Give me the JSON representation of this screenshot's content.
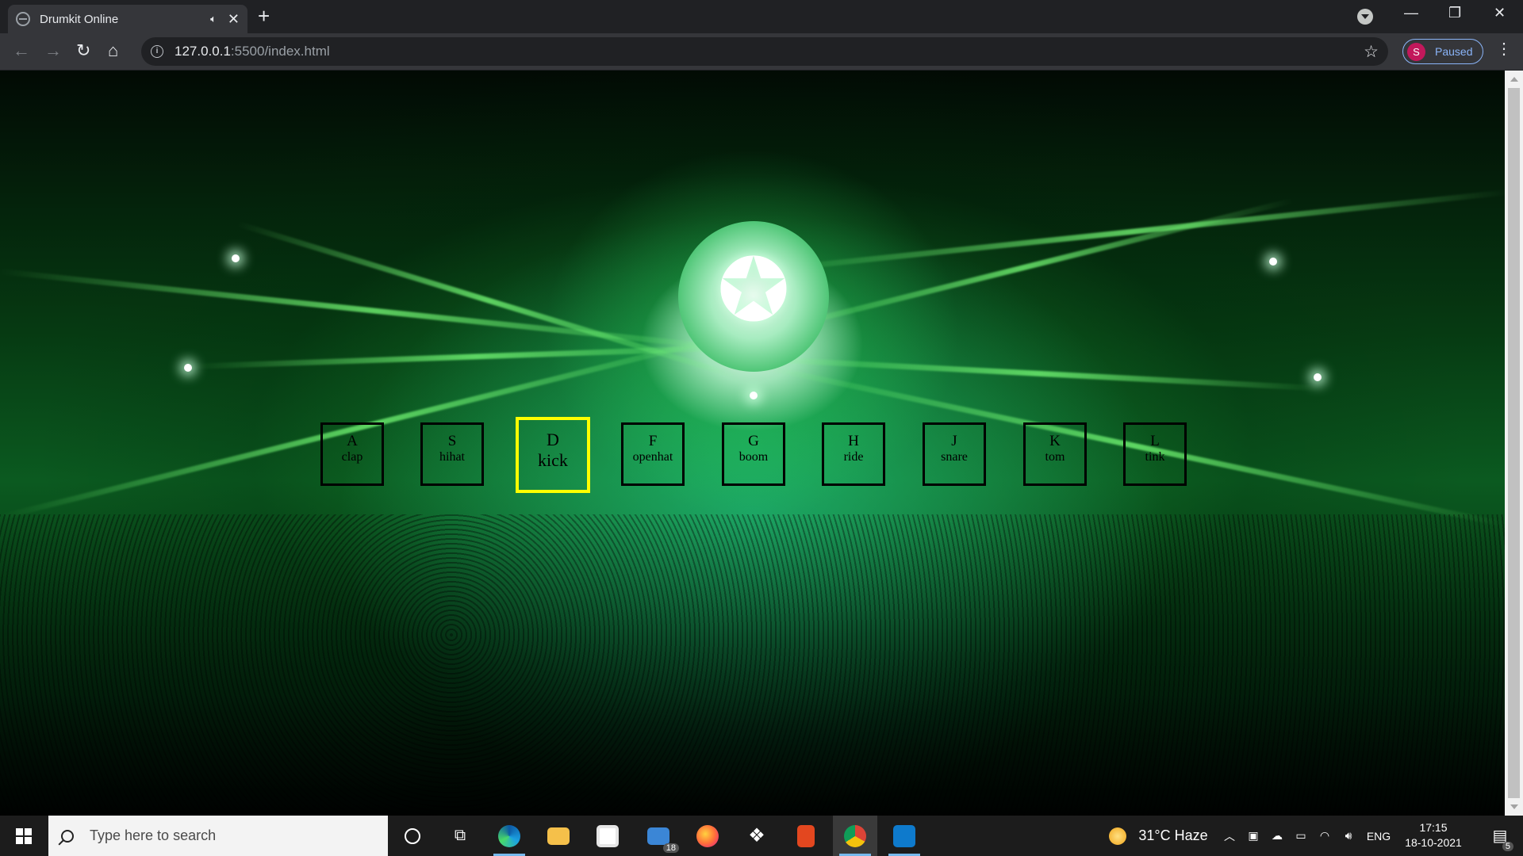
{
  "tab": {
    "title": "Drumkit Online",
    "speaker_icon": "speaker-icon",
    "close": "✕"
  },
  "new_tab": "+",
  "window_controls": {
    "minimize": "—",
    "maximize": "❐",
    "close": "✕"
  },
  "toolbar": {
    "back": "←",
    "forward": "→",
    "reload": "↻",
    "home": "⌂",
    "url_host": "127.0.0.1",
    "url_path": ":5500/index.html",
    "bookmark": "☆",
    "profile_initial": "S",
    "profile_status": "Paused",
    "menu": "⋮"
  },
  "hero": {
    "star_glyph": "✪"
  },
  "keys": [
    {
      "letter": "A",
      "sound": "clap"
    },
    {
      "letter": "S",
      "sound": "hihat"
    },
    {
      "letter": "D",
      "sound": "kick",
      "playing": true
    },
    {
      "letter": "F",
      "sound": "openhat"
    },
    {
      "letter": "G",
      "sound": "boom"
    },
    {
      "letter": "H",
      "sound": "ride"
    },
    {
      "letter": "J",
      "sound": "snare"
    },
    {
      "letter": "K",
      "sound": "tom"
    },
    {
      "letter": "L",
      "sound": "tink"
    }
  ],
  "taskbar": {
    "search_placeholder": "Type here to search",
    "mail_badge": "18",
    "weather": "31°C  Haze",
    "language": "ENG",
    "time": "17:15",
    "date": "18-10-2021",
    "notification_badge": "5",
    "pinned_apps": [
      "cortana-icon",
      "task-view-icon",
      "edge-icon",
      "file-explorer-icon",
      "store-icon",
      "mail-icon",
      "firefox-icon",
      "dropbox-icon",
      "office-icon",
      "chrome-icon",
      "vscode-icon"
    ]
  },
  "colors": {
    "accent_playing": "#ffff00",
    "tab_bg": "#35363a",
    "frame_bg": "#202124",
    "profile_accent": "#8ab4f8"
  }
}
